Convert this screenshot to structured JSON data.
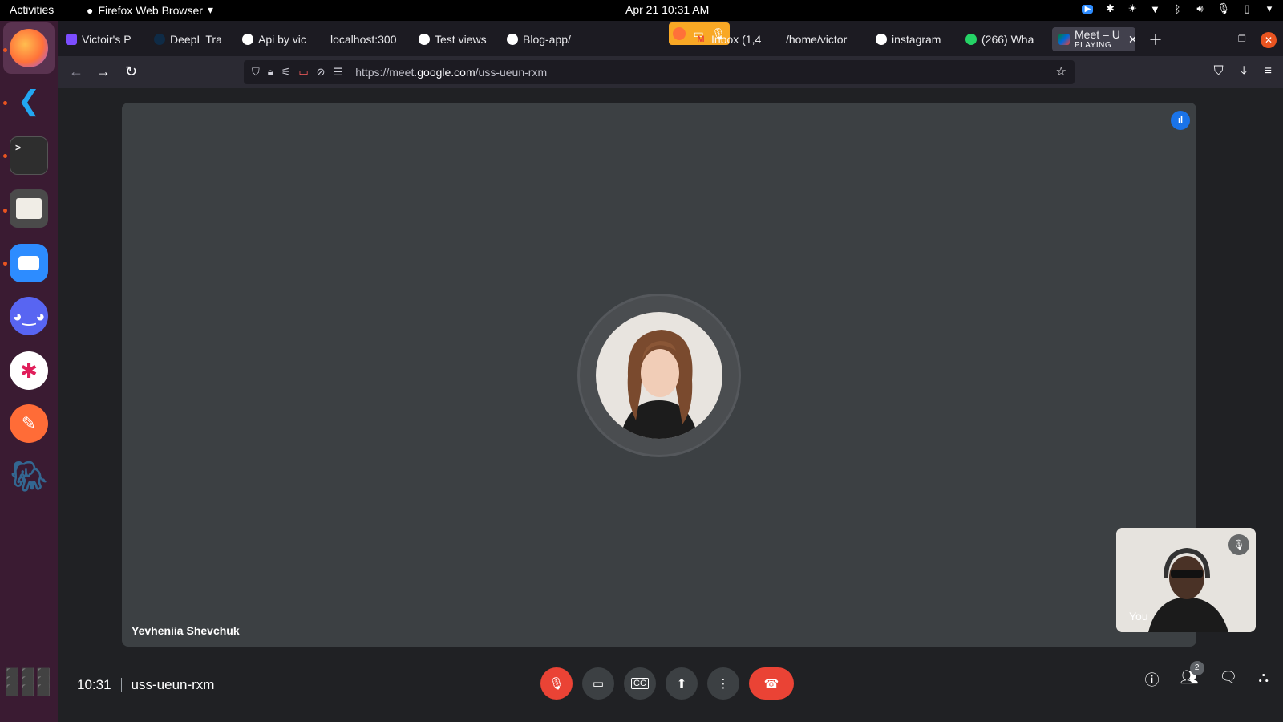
{
  "topbar": {
    "activities": "Activities",
    "app_menu": "Firefox Web Browser",
    "clock": "Apr 21  10:31 AM"
  },
  "tabs": [
    {
      "label": "Victoir's P",
      "icon": "canva-icon",
      "color": "#7c4dff"
    },
    {
      "label": "DeepL Tra",
      "icon": "deepl-icon",
      "color": "#0f2b46"
    },
    {
      "label": "Api by vic",
      "icon": "github-icon",
      "color": "#ffffff"
    },
    {
      "label": "localhost:300",
      "icon": "",
      "color": ""
    },
    {
      "label": "Test views",
      "icon": "github-icon",
      "color": "#ffffff"
    },
    {
      "label": "Blog-app/",
      "icon": "github-icon",
      "color": "#ffffff"
    },
    {
      "label": "Inbox (1,4",
      "icon": "gmail-icon",
      "color": "#ea4335"
    },
    {
      "label": "/home/victor",
      "icon": "",
      "color": ""
    },
    {
      "label": "instagram",
      "icon": "github-icon",
      "color": "#ffffff"
    },
    {
      "label": "(266) Wha",
      "icon": "whatsapp-icon",
      "color": "#25d366"
    }
  ],
  "active_tab": {
    "label": "Meet – U",
    "sublabel": "PLAYING"
  },
  "url": {
    "prefix": "https://meet.",
    "domain": "google.com",
    "path": "/uss-ueun-rxm"
  },
  "meeting": {
    "participant_name": "Yevheniia Shevchuk",
    "self_label": "You",
    "time": "10:31",
    "code": "uss-ueun-rxm",
    "people_count": "2"
  },
  "colors": {
    "accent": "#1a73e8",
    "danger": "#ea4335",
    "stage": "#3c4043"
  }
}
